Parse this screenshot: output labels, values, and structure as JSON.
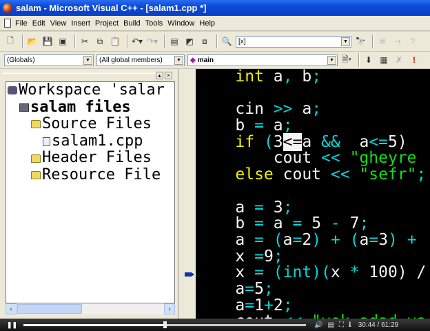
{
  "window": {
    "title": "salam - Microsoft Visual C++ - [salam1.cpp *]"
  },
  "menu": [
    "File",
    "Edit",
    "View",
    "Insert",
    "Project",
    "Build",
    "Tools",
    "Window",
    "Help"
  ],
  "toolbar": {
    "find_combo": "[x]"
  },
  "wizard_bar": {
    "scope": "(Globals)",
    "members": "(All global members)",
    "function": "main"
  },
  "workspace": {
    "items": [
      {
        "label": "Workspace 'salar",
        "indent": 0,
        "icon": "workspace-icon",
        "bold": false
      },
      {
        "label": "salam files",
        "indent": 1,
        "icon": "project-icon",
        "bold": true
      },
      {
        "label": "Source Files",
        "indent": 2,
        "icon": "folder-icon",
        "bold": false
      },
      {
        "label": "salam1.cpp",
        "indent": 3,
        "icon": "cpp-file-icon",
        "bold": false
      },
      {
        "label": "Header Files",
        "indent": 2,
        "icon": "folder-icon",
        "bold": false
      },
      {
        "label": "Resource File",
        "indent": 2,
        "icon": "folder-icon",
        "bold": false
      }
    ]
  },
  "editor": {
    "lines": [
      [
        [
          "    ",
          "id"
        ],
        [
          "int",
          "kw"
        ],
        [
          " a",
          "id"
        ],
        [
          ",",
          "op"
        ],
        [
          " b",
          "id"
        ],
        [
          ";",
          "op"
        ]
      ],
      [],
      [
        [
          "    cin ",
          "id"
        ],
        [
          ">>",
          "op"
        ],
        [
          " a",
          "id"
        ],
        [
          ";",
          "op"
        ]
      ],
      [
        [
          "    b ",
          "id"
        ],
        [
          "=",
          "op"
        ],
        [
          " a",
          "id"
        ],
        [
          ";",
          "op"
        ]
      ],
      [
        [
          "    ",
          "id"
        ],
        [
          "if",
          "kw"
        ],
        [
          " (",
          "op"
        ],
        [
          "3",
          "id"
        ],
        [
          "<=",
          "sel"
        ],
        [
          "a ",
          "id"
        ],
        [
          "&&",
          "op"
        ],
        [
          "  a",
          "id"
        ],
        [
          "<=",
          "op"
        ],
        [
          "5)",
          "id"
        ]
      ],
      [
        [
          "        cout ",
          "id"
        ],
        [
          "<<",
          "op"
        ],
        [
          " \"gheyre",
          "str"
        ]
      ],
      [
        [
          "    ",
          "id"
        ],
        [
          "else",
          "kw"
        ],
        [
          " cout ",
          "id"
        ],
        [
          "<<",
          "op"
        ],
        [
          " \"sefr\"",
          "str"
        ],
        [
          ";",
          "op"
        ]
      ],
      [],
      [
        [
          "    a ",
          "id"
        ],
        [
          "=",
          "op"
        ],
        [
          " 3",
          "id"
        ],
        [
          ";",
          "op"
        ]
      ],
      [
        [
          "    b ",
          "id"
        ],
        [
          "=",
          "op"
        ],
        [
          " a ",
          "id"
        ],
        [
          "=",
          "op"
        ],
        [
          " 5 ",
          "id"
        ],
        [
          "-",
          "op"
        ],
        [
          " 7",
          "id"
        ],
        [
          ";",
          "op"
        ]
      ],
      [
        [
          "    a ",
          "id"
        ],
        [
          "=",
          "op"
        ],
        [
          " (",
          "op"
        ],
        [
          "a",
          "id"
        ],
        [
          "=",
          "op"
        ],
        [
          "2",
          "id"
        ],
        [
          ")",
          "op"
        ],
        [
          " +",
          "op"
        ],
        [
          " (",
          "op"
        ],
        [
          "a",
          "id"
        ],
        [
          "=",
          "op"
        ],
        [
          "3",
          "id"
        ],
        [
          ")",
          "op"
        ],
        [
          " +",
          "op"
        ]
      ],
      [
        [
          "    x ",
          "id"
        ],
        [
          "=",
          "op"
        ],
        [
          "9",
          "id"
        ],
        [
          ";",
          "op"
        ]
      ],
      [
        [
          "    x ",
          "id"
        ],
        [
          "=",
          "op"
        ],
        [
          " (int)(",
          "op"
        ],
        [
          "x ",
          "id"
        ],
        [
          "*",
          "op"
        ],
        [
          " 100) /",
          "id"
        ]
      ],
      [
        [
          "    a",
          "id"
        ],
        [
          "=",
          "op"
        ],
        [
          "5",
          "id"
        ],
        [
          ";",
          "op"
        ]
      ],
      [
        [
          "    a",
          "id"
        ],
        [
          "=",
          "op"
        ],
        [
          "1",
          "id"
        ],
        [
          "+",
          "op"
        ],
        [
          "2",
          "id"
        ],
        [
          ";",
          "op"
        ]
      ],
      [
        [
          "    cout ",
          "id"
        ],
        [
          "<<",
          "op"
        ],
        [
          " \"yek adad va",
          "str"
        ]
      ]
    ]
  },
  "player": {
    "current_time": "30:44",
    "total_time": "61:29",
    "time_display": "30:44 / 61:29",
    "progress": 0.5,
    "state": "playing"
  }
}
